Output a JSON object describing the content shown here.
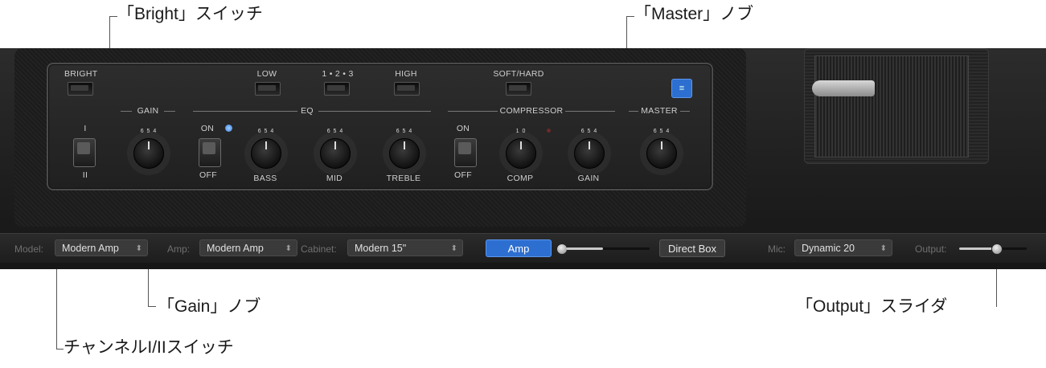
{
  "callouts": {
    "bright": "「Bright」スイッチ",
    "master": "「Master」ノブ",
    "gain": "「Gain」ノブ",
    "output": "「Output」スライダ",
    "channel": "チャンネルI/IIスイッチ"
  },
  "amp_panel": {
    "bright_label": "BRIGHT",
    "low_label": "LOW",
    "mid_select_label": "1 • 2 • 3",
    "high_label": "HIGH",
    "softhard_label": "SOFT/HARD",
    "gain_section": "GAIN",
    "eq_section": "EQ",
    "compressor_section": "COMPRESSOR",
    "master_section": "MASTER",
    "channel_top": "I",
    "channel_bottom": "II",
    "eq_on": "ON",
    "eq_off": "OFF",
    "comp_on": "ON",
    "comp_off": "OFF",
    "bass": "BASS",
    "mid": "MID",
    "treble": "TREBLE",
    "comp": "COMP",
    "comp_gain": "GAIN",
    "knob_scale": "6 5 4",
    "comp_scale": "1 0"
  },
  "toolbar": {
    "model_label": "Model:",
    "model_value": "Modern Amp",
    "amp_label": "Amp:",
    "amp_value": "Modern Amp",
    "cabinet_label": "Cabinet:",
    "cabinet_value": "Modern 15\"",
    "amp_button": "Amp",
    "direct_box_button": "Direct Box",
    "mic_label": "Mic:",
    "mic_value": "Dynamic 20",
    "output_label": "Output:"
  },
  "colors": {
    "accent_blue": "#2d6fd0",
    "panel_dark": "#1e1e1e"
  }
}
